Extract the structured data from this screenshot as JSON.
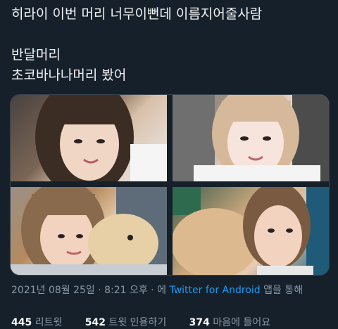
{
  "tweet": {
    "lines": [
      "히라이 이번 머리 너무이뻔데 이름지어줄사람",
      "반달머리",
      "초코바나나머리 봤어"
    ]
  },
  "photos": [
    {
      "name": "photo-1"
    },
    {
      "name": "photo-2"
    },
    {
      "name": "photo-3"
    },
    {
      "name": "photo-4"
    }
  ],
  "meta": {
    "date": "2021년 08월 25일 · 8:21 오후 · 에",
    "source": "Twitter for Android",
    "suffix": "앱을 통해"
  },
  "stats": {
    "retweets_count": "445",
    "retweets_label": "리트윗",
    "quotes_count": "542",
    "quotes_label": "트윗 인용하기",
    "likes_count": "374",
    "likes_label": "마음에 들어요"
  }
}
